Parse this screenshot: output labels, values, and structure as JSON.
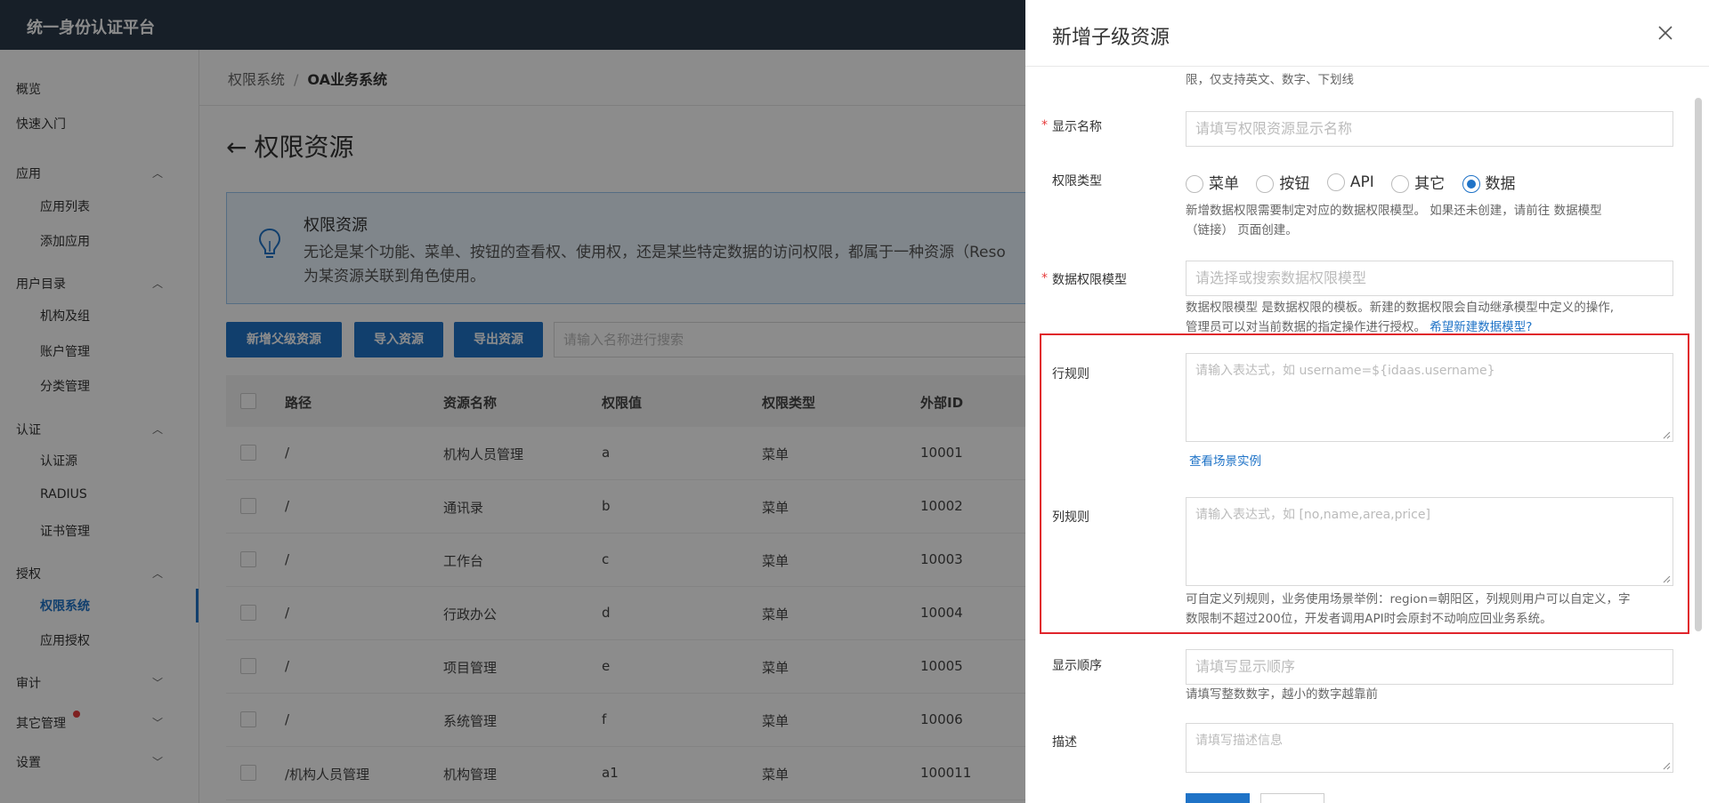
{
  "topbar": {
    "brand": "统一身份认证平台"
  },
  "sidebar": {
    "overview": "概览",
    "quickstart": "快速入门",
    "app": "应用",
    "app_list": "应用列表",
    "app_add": "添加应用",
    "user_dir": "用户目录",
    "org": "机构及组",
    "account": "账户管理",
    "category": "分类管理",
    "auth": "认证",
    "auth_source": "认证源",
    "radius": "RADIUS",
    "cert": "证书管理",
    "authorize": "授权",
    "perm_system": "权限系统",
    "app_authorize": "应用授权",
    "audit": "审计",
    "other": "其它管理",
    "settings": "设置"
  },
  "main": {
    "breadcrumb": {
      "root": "权限系统",
      "sep": "/",
      "current": "OA业务系统"
    },
    "title": "权限资源",
    "info": {
      "title": "权限资源",
      "line1": "无论是某个功能、菜单、按钮的查看权、使用权，还是某些特定数据的访问权限，都属于一种资源（Reso",
      "line2": "为某资源关联到角色使用。"
    },
    "buttons": {
      "add_parent": "新增父级资源",
      "import": "导入资源",
      "export": "导出资源"
    },
    "search_placeholder": "请输入名称进行搜索",
    "table": {
      "headers": [
        "路径",
        "资源名称",
        "权限值",
        "权限类型",
        "外部ID"
      ],
      "rows": [
        [
          "/",
          "机构人员管理",
          "a",
          "菜单",
          "10001"
        ],
        [
          "/",
          "通讯录",
          "b",
          "菜单",
          "10002"
        ],
        [
          "/",
          "工作台",
          "c",
          "菜单",
          "10003"
        ],
        [
          "/",
          "行政办公",
          "d",
          "菜单",
          "10004"
        ],
        [
          "/",
          "项目管理",
          "e",
          "菜单",
          "10005"
        ],
        [
          "/",
          "系统管理",
          "f",
          "菜单",
          "10006"
        ],
        [
          "/机构人员管理",
          "机构管理",
          "a1",
          "菜单",
          "100011"
        ]
      ]
    }
  },
  "drawer": {
    "title": "新增子级资源",
    "top_hint": "限，仅支持英文、数字、下划线",
    "display_name": {
      "label": "显示名称",
      "placeholder": "请填写权限资源显示名称",
      "required": "*"
    },
    "perm_type": {
      "label": "权限类型",
      "options": [
        "菜单",
        "按钮",
        "API",
        "其它",
        "数据"
      ],
      "selected": "数据",
      "hint1": "新增数据权限需要制定对应的数据权限模型。 如果还未创建，请前往 数据模型",
      "hint2": "（链接） 页面创建。"
    },
    "data_model": {
      "label": "数据权限模型",
      "required": "*",
      "placeholder": "请选择或搜索数据权限模型",
      "hint1": "数据权限模型 是数据权限的模板。新建的数据权限会自动继承模型中定义的操作,",
      "hint2": "管理员可以对当前数据的指定操作进行授权。",
      "hint_link": "希望新建数据模型?"
    },
    "row_rule": {
      "label": "行规则",
      "placeholder": "请输入表达式，如 username=${idaas.username}",
      "link": "查看场景实例"
    },
    "col_rule": {
      "label": "列规则",
      "placeholder": "请输入表达式，如 [no,name,area,price]",
      "hint1": "可自定义列规则，业务使用场景举例：region=朝阳区，列规则用户可以自定义，字",
      "hint2": "数限制不超过200位，开发者调用API时会原封不动响应回业务系统。"
    },
    "order": {
      "label": "显示顺序",
      "placeholder": "请填写显示顺序",
      "hint": "请填写整数数字，越小的数字越靠前"
    },
    "desc": {
      "label": "描述",
      "placeholder": "请填写描述信息"
    }
  }
}
